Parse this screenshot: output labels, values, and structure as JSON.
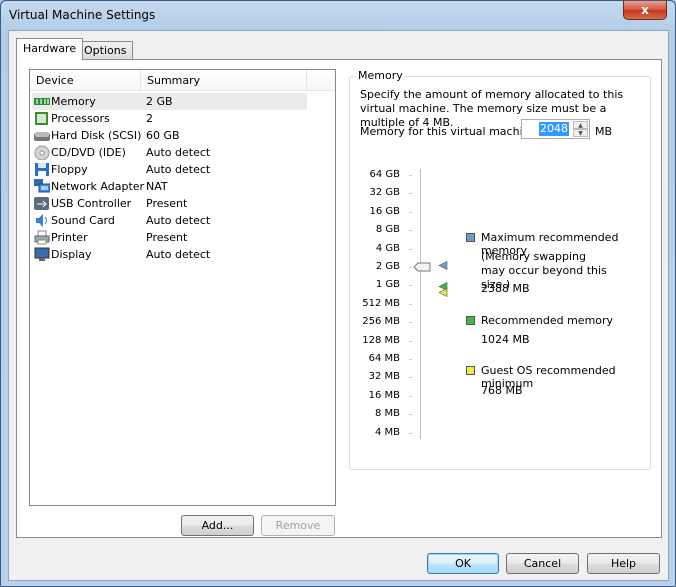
{
  "window": {
    "title": "Virtual Machine Settings",
    "close_label": "x"
  },
  "tabs": [
    {
      "label": "Hardware",
      "active": true
    },
    {
      "label": "Options",
      "active": false
    }
  ],
  "device_list": {
    "columns": [
      "Device",
      "Summary"
    ],
    "rows": [
      {
        "icon": "memory-icon",
        "device": "Memory",
        "summary": "2 GB",
        "selected": true
      },
      {
        "icon": "processor-icon",
        "device": "Processors",
        "summary": "2"
      },
      {
        "icon": "hard-disk-icon",
        "device": "Hard Disk (SCSI)",
        "summary": "60 GB"
      },
      {
        "icon": "cd-dvd-icon",
        "device": "CD/DVD (IDE)",
        "summary": "Auto detect"
      },
      {
        "icon": "floppy-icon",
        "device": "Floppy",
        "summary": "Auto detect"
      },
      {
        "icon": "network-adapter-icon",
        "device": "Network Adapter",
        "summary": "NAT"
      },
      {
        "icon": "usb-icon",
        "device": "USB Controller",
        "summary": "Present"
      },
      {
        "icon": "sound-card-icon",
        "device": "Sound Card",
        "summary": "Auto detect"
      },
      {
        "icon": "printer-icon",
        "device": "Printer",
        "summary": "Present"
      },
      {
        "icon": "display-icon",
        "device": "Display",
        "summary": "Auto detect"
      }
    ],
    "add_label": "Add...",
    "remove_label": "Remove"
  },
  "memory": {
    "group_title": "Memory",
    "description": "Specify the amount of memory allocated to this virtual machine. The memory size must be a multiple of 4 MB.",
    "field_label": "Memory for this virtual machine:",
    "value": "2048",
    "unit": "MB",
    "slider": {
      "ticks": [
        "64 GB",
        "32 GB",
        "16 GB",
        "8 GB",
        "4 GB",
        "2 GB",
        "1 GB",
        "512 MB",
        "256 MB",
        "128 MB",
        "64 MB",
        "32 MB",
        "16 MB",
        "8 MB",
        "4 MB"
      ],
      "current": "2 GB"
    },
    "legend": {
      "max": {
        "label": "Maximum recommended memory",
        "note": "(Memory swapping may occur beyond this size.)",
        "value": "2388 MB",
        "color": "#6f9bd1"
      },
      "recommended": {
        "label": "Recommended memory",
        "value": "1024 MB",
        "color": "#46b446"
      },
      "guest_min": {
        "label": "Guest OS recommended minimum",
        "value": "768 MB",
        "color": "#f0e650"
      }
    }
  },
  "footer": {
    "ok_label": "OK",
    "cancel_label": "Cancel",
    "help_label": "Help"
  }
}
